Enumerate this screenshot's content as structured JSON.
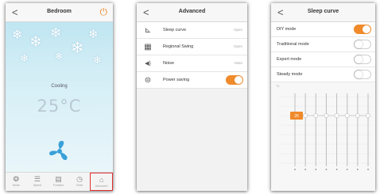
{
  "panel1": {
    "title": "Bedroom",
    "back": "<",
    "power_icon": "power-icon",
    "mode": "Cooling",
    "temperature": "25°C",
    "colors": {
      "accent": "#f08a2a",
      "sky": "#cde9f3",
      "highlight": "#e03030"
    },
    "nav": [
      {
        "label": "Mode",
        "icon": "mode-icon",
        "glyph": "❂"
      },
      {
        "label": "Speed",
        "icon": "speed-icon",
        "glyph": "☰"
      },
      {
        "label": "Function",
        "icon": "function-icon",
        "glyph": "▤"
      },
      {
        "label": "Timer",
        "icon": "timer-icon",
        "glyph": "◷"
      },
      {
        "label": "Advanced",
        "icon": "advanced-icon",
        "glyph": "⌂"
      }
    ]
  },
  "panel2": {
    "title": "Advanced",
    "back": "<",
    "rows": [
      {
        "label": "Sleep curve",
        "value": "Open",
        "icon": "sleep-curve-icon",
        "glyph": "⊾"
      },
      {
        "label": "Regional Swing",
        "value": "Open",
        "icon": "regional-swing-icon",
        "glyph": "▦"
      },
      {
        "label": "Noise",
        "value": "Mute",
        "icon": "noise-icon",
        "glyph": "◀)"
      },
      {
        "label": "Power saving",
        "toggle": "on",
        "icon": "power-saving-icon",
        "glyph": "⊜"
      }
    ]
  },
  "panel3": {
    "title": "Sleep curve",
    "back": "<",
    "modes": [
      {
        "label": "DIY mode",
        "toggle": "on"
      },
      {
        "label": "Traditional mode",
        "toggle": "off"
      },
      {
        "label": "Expert mode",
        "toggle": "off"
      },
      {
        "label": "Steady mode",
        "toggle": "off"
      }
    ],
    "curve": {
      "unit": "°C",
      "points": [
        26,
        26,
        26,
        26,
        26,
        26,
        26,
        26
      ],
      "selected_index": 0,
      "selected_label": "26",
      "ymin": 16,
      "ymax": 30
    }
  }
}
